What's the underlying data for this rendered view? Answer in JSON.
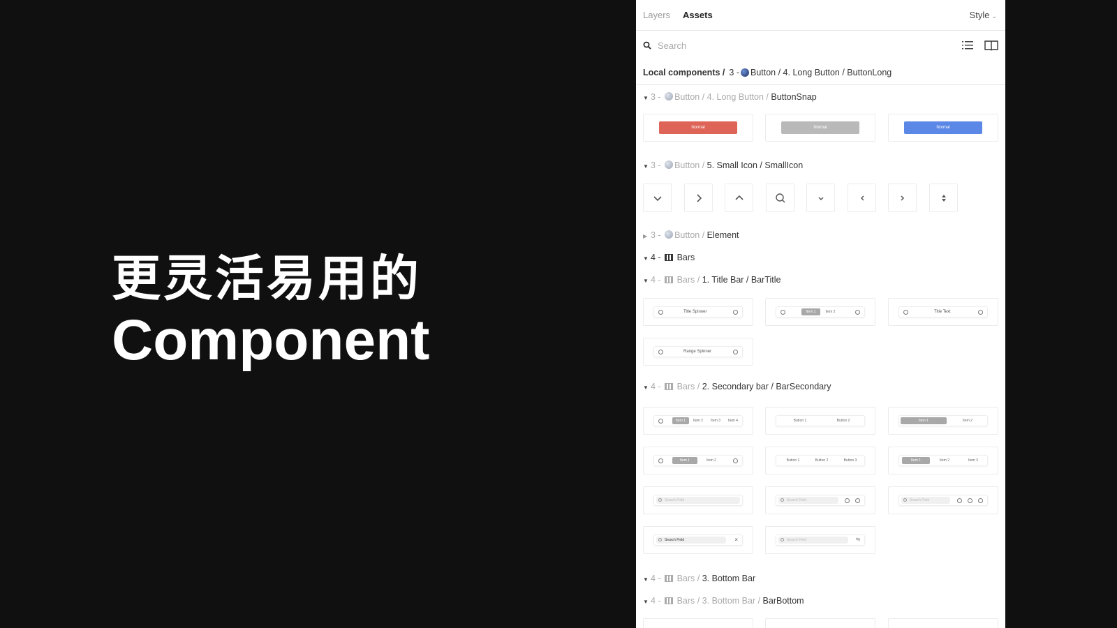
{
  "hero": {
    "line1": "更灵活易用的",
    "line2": "Component"
  },
  "panel": {
    "tabs": [
      "Layers",
      "Assets"
    ],
    "active_tab": "Assets",
    "style_label": "Style",
    "search_placeholder": "Search",
    "breadcrumb": {
      "root": "Local components /",
      "prefix": "3 -",
      "path": "Button / 4. Long Button / ButtonLong"
    },
    "sections": [
      {
        "num": "3 -",
        "muted": "Button / 4. Long Button /",
        "label": "ButtonSnap",
        "expanded": true
      },
      {
        "num": "3 -",
        "muted": "Button /",
        "label": "5. Small Icon / SmallIcon",
        "expanded": true
      },
      {
        "num": "3 -",
        "muted": "Button /",
        "label": "Element",
        "expanded": false
      },
      {
        "num": "4 -",
        "muted": "",
        "label": "Bars",
        "expanded": true
      },
      {
        "num": "4 -",
        "muted": "Bars /",
        "label": "1. Title Bar / BarTitle",
        "expanded": true
      },
      {
        "num": "4 -",
        "muted": "Bars /",
        "label": "2. Secondary bar / BarSecondary",
        "expanded": true
      },
      {
        "num": "4 -",
        "muted": "Bars /",
        "label": "3. Bottom Bar",
        "expanded": true
      },
      {
        "num": "4 -",
        "muted": "Bars / 3. Bottom Bar /",
        "label": "BarBottom",
        "expanded": true
      }
    ],
    "long_buttons": [
      {
        "label": "Normal",
        "color": "#de6457"
      },
      {
        "label": "Normal",
        "color": "#b9b9b9"
      },
      {
        "label": "Normal",
        "color": "#5b87e6"
      }
    ],
    "small_icons": [
      "chevron-down-icon",
      "chevron-right-icon",
      "chevron-up-icon",
      "search-icon",
      "small-chevron-down-icon",
      "chevron-left-icon",
      "small-chevron-right-icon",
      "sort-icon"
    ],
    "title_bars": [
      "Title Spinner",
      "Item 1",
      "Item 2",
      "Title Text",
      "Range Spinner"
    ],
    "secondary": {
      "items4": [
        "Item 1",
        "Item 2",
        "Item 3",
        "Item 4"
      ],
      "buttons2": [
        "Button 1",
        "Button 2"
      ],
      "items2": [
        "Item 1",
        "Item 2"
      ],
      "items2b": [
        "Item 1",
        "Item 2"
      ],
      "buttons3": [
        "Button 1",
        "Button 2",
        "Button 3"
      ],
      "items3": [
        "Item 1",
        "Item 2",
        "Item 3"
      ],
      "search": "Search Field"
    }
  }
}
